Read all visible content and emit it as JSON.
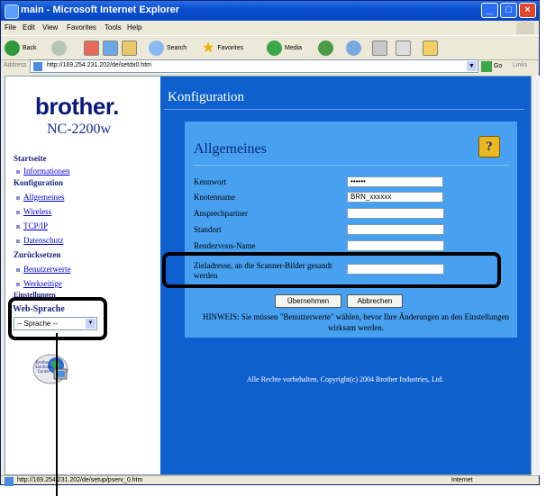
{
  "window": {
    "title": "main - Microsoft Internet Explorer"
  },
  "menu": [
    "File",
    "Edit",
    "View",
    "Favorites",
    "Tools",
    "Help"
  ],
  "toolbar": {
    "back": "Back",
    "search": "Search",
    "favorites": "Favorites",
    "media": "Media"
  },
  "address": {
    "label": "Address",
    "url": "http://169.254.231.202/de/setdx0.htm",
    "go": "Go",
    "links": "Links"
  },
  "sidebar": {
    "logo": "brother.",
    "model": "NC-2200w",
    "startseite": "Startseite",
    "informationen": "Informationen",
    "konfiguration": "Konfiguration",
    "allgemeines": "Allgemeines",
    "wireless": "Wireless",
    "tcpip": "TCP/IP",
    "datenschutz": "Datenschutz",
    "zuruecksetzen": "Zurücksetzen",
    "benutzerwerte": "Benutzerwerte",
    "werksseitige": "Werkseitige",
    "einstellungen": "Einstellungen",
    "web_sprache": "Web-Sprache",
    "sprache_select": "-- Sprache --",
    "brother_logo_text": "Brother Solutions Center"
  },
  "content": {
    "title": "Konfiguration",
    "panel_title": "Allgemeines",
    "help_icon": "?",
    "fields": {
      "kennwort": {
        "label": "Kennwort",
        "value": "••••••"
      },
      "knotenname": {
        "label": "Knotenname",
        "value": "BRN_xxxxxx"
      },
      "ansprechpartner": {
        "label": "Ansprechpartner",
        "value": ""
      },
      "standort": {
        "label": "Standort",
        "value": ""
      },
      "rendezvous": {
        "label": "Rendezvous-Name",
        "value": ""
      },
      "zieladresse": {
        "label": "Zieladresse, an die Scanner-Bilder gesandt werden",
        "value": ""
      }
    },
    "btn_apply": "Übernehmen",
    "btn_cancel": "Abbrechen",
    "hint": "HINWEIS: Sie müssen \"Benutzerwerte\" wählen, bevor Ihre Änderungen an den Einstellungen wirksam werden.",
    "copyright": "Alle Rechte vorbehalten. Copyright(c) 2004 Brother Industries, Ltd."
  },
  "status": {
    "text": "http://169.254.231.202/de/setup/pserv_0.htm",
    "zone": "Internet"
  }
}
